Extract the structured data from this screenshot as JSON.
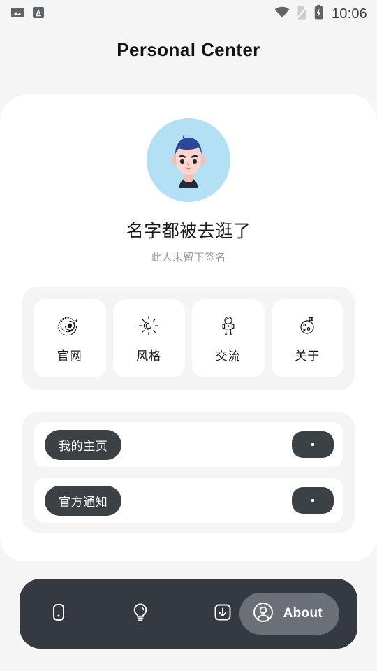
{
  "status_bar": {
    "left_icons": [
      {
        "name": "image-icon"
      },
      {
        "name": "letter-a-icon"
      }
    ],
    "right_icons": [
      {
        "name": "wifi-icon"
      },
      {
        "name": "no-sim-icon"
      },
      {
        "name": "battery-charging-icon"
      }
    ],
    "time": "10:06"
  },
  "header": {
    "title": "Personal Center"
  },
  "profile": {
    "avatar_name": "user-avatar",
    "username": "名字都被去逛了",
    "signature": "此人未留下签名",
    "avatar_colors": {
      "background": "#b3e0f5",
      "hair": "#2b4896",
      "skin": "#fcd5cf",
      "shirt": "#222a33"
    }
  },
  "quick_actions": [
    {
      "label": "官网",
      "icon": "galaxy-icon"
    },
    {
      "label": "风格",
      "icon": "sun-spiral-icon"
    },
    {
      "label": "交流",
      "icon": "astronaut-icon"
    },
    {
      "label": "关于",
      "icon": "planet-flag-icon"
    }
  ],
  "list_rows": [
    {
      "label": "我的主页",
      "action_icon": "more-dot-icon"
    },
    {
      "label": "官方通知",
      "action_icon": "more-dot-icon"
    }
  ],
  "bottom_nav": {
    "items": [
      {
        "icon": "device-icon",
        "label": "",
        "active": false
      },
      {
        "icon": "lightbulb-icon",
        "label": "",
        "active": false
      },
      {
        "icon": "download-box-icon",
        "label": "",
        "active": false
      }
    ],
    "active_item": {
      "icon": "user-circle-icon",
      "label": "About",
      "active": true
    },
    "colors": {
      "bar": "#343a40",
      "active_pill": "#6b7076"
    }
  },
  "colors": {
    "page_background": "#f5f5f6",
    "panel": "#ffffff",
    "group": "#f4f4f5",
    "dark": "#3c4146",
    "text": "#16181b",
    "muted": "#9b9ea3"
  }
}
